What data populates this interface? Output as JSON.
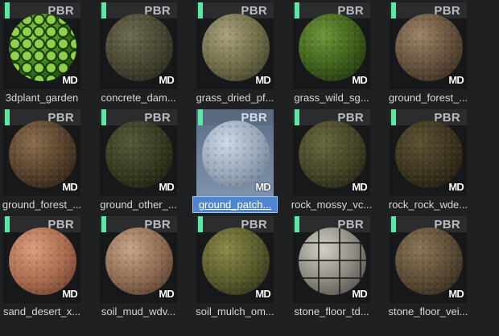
{
  "badges": {
    "type": "PBR",
    "source": "MD"
  },
  "colors": {
    "pbr_marker": "#5de8a6",
    "selection": "#4f86cf"
  },
  "materials": [
    {
      "name": "3dplant_garden",
      "selected": false,
      "swatch": [
        "#8fd14a",
        "#3e7a1c",
        "#123308"
      ],
      "pattern": "cells"
    },
    {
      "name": "concrete_dam...",
      "selected": false,
      "swatch": [
        "#6e6a4e",
        "#464330",
        "#1c1b12"
      ],
      "pattern": ""
    },
    {
      "name": "grass_dried_pf...",
      "selected": false,
      "swatch": [
        "#a7a27a",
        "#6e6b48",
        "#2f2d1d"
      ],
      "pattern": ""
    },
    {
      "name": "grass_wild_sg...",
      "selected": false,
      "swatch": [
        "#6e9638",
        "#3d5e1a",
        "#152509"
      ],
      "pattern": ""
    },
    {
      "name": "ground_forest_...",
      "selected": false,
      "swatch": [
        "#9c8466",
        "#624e3a",
        "#281e14"
      ],
      "pattern": ""
    },
    {
      "name": "ground_forest_...",
      "selected": false,
      "swatch": [
        "#8a6e4e",
        "#553f2a",
        "#201710"
      ],
      "pattern": ""
    },
    {
      "name": "ground_other_...",
      "selected": false,
      "swatch": [
        "#525a38",
        "#33391f",
        "#12150a"
      ],
      "pattern": ""
    },
    {
      "name": "ground_patch...",
      "selected": true,
      "swatch": [
        "#ced8e4",
        "#97a6b8",
        "#5e6e82"
      ],
      "pattern": ""
    },
    {
      "name": "rock_mossy_vc...",
      "selected": false,
      "swatch": [
        "#68683e",
        "#434326",
        "#17170c"
      ],
      "pattern": ""
    },
    {
      "name": "rock_rock_wde...",
      "selected": false,
      "swatch": [
        "#5a5232",
        "#3a331d",
        "#15120a"
      ],
      "pattern": ""
    },
    {
      "name": "sand_desert_x...",
      "selected": false,
      "swatch": [
        "#dc9d7e",
        "#aa6a4e",
        "#52301f"
      ],
      "pattern": ""
    },
    {
      "name": "soil_mud_wdv...",
      "selected": false,
      "swatch": [
        "#c8a386",
        "#8e6a52",
        "#3f2c20"
      ],
      "pattern": ""
    },
    {
      "name": "soil_mulch_om...",
      "selected": false,
      "swatch": [
        "#8a8a48",
        "#58592b",
        "#22220f"
      ],
      "pattern": ""
    },
    {
      "name": "stone_floor_td...",
      "selected": false,
      "swatch": [
        "#d2d0c8",
        "#8a877e",
        "#3c3a35"
      ],
      "pattern": "tiles"
    },
    {
      "name": "stone_floor_vei...",
      "selected": false,
      "swatch": [
        "#8a7456",
        "#5a4a34",
        "#221c13"
      ],
      "pattern": ""
    }
  ]
}
